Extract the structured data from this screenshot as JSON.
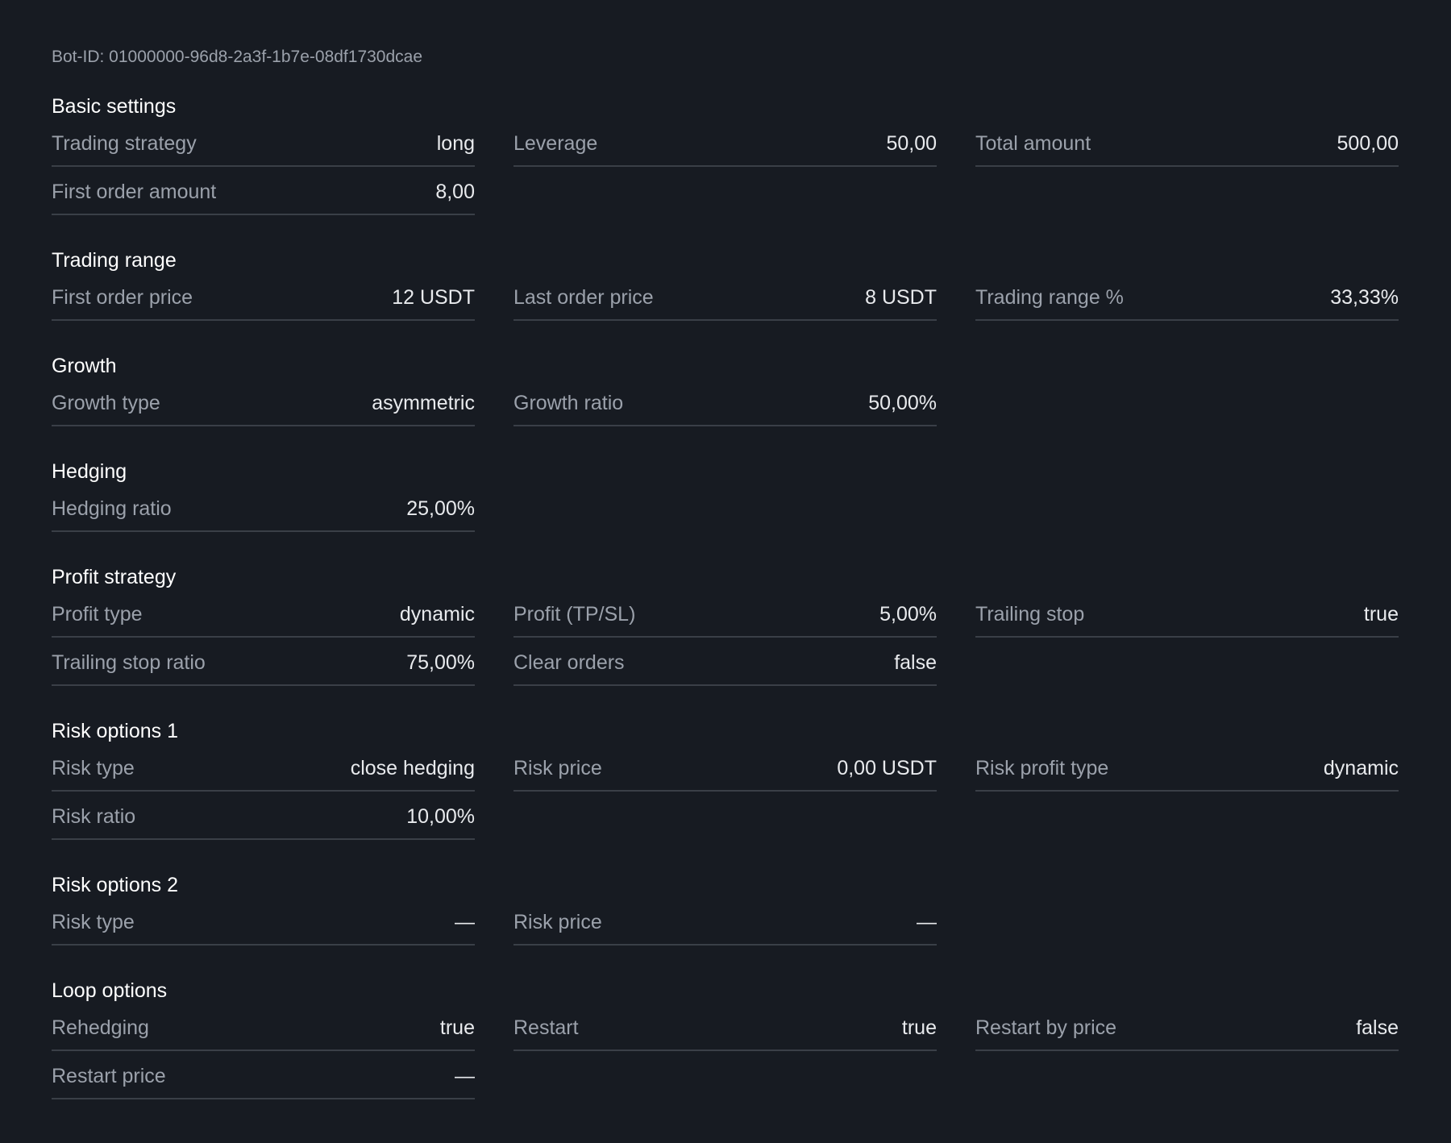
{
  "bot_id": "Bot-ID: 01000000-96d8-2a3f-1b7e-08df1730dcae",
  "sections": [
    {
      "title": "Basic settings",
      "rows": [
        [
          {
            "label": "Trading strategy",
            "value": "long"
          },
          {
            "label": "Leverage",
            "value": "50,00"
          },
          {
            "label": "Total amount",
            "value": "500,00"
          }
        ],
        [
          {
            "label": "First order amount",
            "value": "8,00"
          }
        ]
      ]
    },
    {
      "title": "Trading range",
      "rows": [
        [
          {
            "label": "First order price",
            "value": "12 USDT"
          },
          {
            "label": "Last order price",
            "value": "8 USDT"
          },
          {
            "label": "Trading range %",
            "value": "33,33%"
          }
        ]
      ]
    },
    {
      "title": "Growth",
      "rows": [
        [
          {
            "label": "Growth type",
            "value": "asymmetric"
          },
          {
            "label": "Growth ratio",
            "value": "50,00%"
          }
        ]
      ]
    },
    {
      "title": "Hedging",
      "rows": [
        [
          {
            "label": "Hedging ratio",
            "value": "25,00%"
          }
        ]
      ]
    },
    {
      "title": "Profit strategy",
      "rows": [
        [
          {
            "label": "Profit type",
            "value": "dynamic"
          },
          {
            "label": "Profit (TP/SL)",
            "value": "5,00%"
          },
          {
            "label": "Trailing stop",
            "value": "true"
          }
        ],
        [
          {
            "label": "Trailing stop ratio",
            "value": "75,00%"
          },
          {
            "label": "Clear orders",
            "value": "false"
          }
        ]
      ]
    },
    {
      "title": "Risk options 1",
      "rows": [
        [
          {
            "label": "Risk type",
            "value": "close hedging"
          },
          {
            "label": "Risk price",
            "value": "0,00 USDT"
          },
          {
            "label": "Risk profit type",
            "value": "dynamic"
          }
        ],
        [
          {
            "label": "Risk ratio",
            "value": "10,00%"
          }
        ]
      ]
    },
    {
      "title": "Risk options 2",
      "rows": [
        [
          {
            "label": "Risk type",
            "value": "—"
          },
          {
            "label": "Risk price",
            "value": "—"
          }
        ]
      ]
    },
    {
      "title": "Loop options",
      "rows": [
        [
          {
            "label": "Rehedging",
            "value": "true"
          },
          {
            "label": "Restart",
            "value": "true"
          },
          {
            "label": "Restart by price",
            "value": "false"
          }
        ],
        [
          {
            "label": "Restart price",
            "value": "—"
          }
        ]
      ]
    }
  ]
}
